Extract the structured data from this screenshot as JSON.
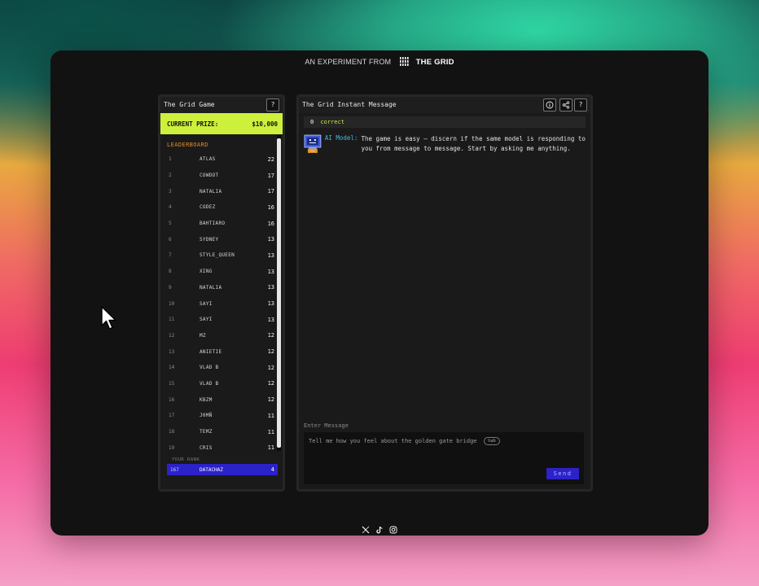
{
  "header": {
    "experiment_text": "AN EXPERIMENT FROM",
    "brand": "THE GRID"
  },
  "leaderboard_panel": {
    "title": "The Grid Game",
    "help_label": "?",
    "prize_label": "CURRENT PRIZE:",
    "prize_value": "$10,000",
    "leaderboard_title": "LEADERBOARD",
    "rows": [
      {
        "rank": "1",
        "name": "ATLAS",
        "score": "22"
      },
      {
        "rank": "2",
        "name": "COWDOT",
        "score": "17"
      },
      {
        "rank": "3",
        "name": "NATALIA",
        "score": "17"
      },
      {
        "rank": "4",
        "name": "CODEZ",
        "score": "16"
      },
      {
        "rank": "5",
        "name": "BAHTIARO",
        "score": "16"
      },
      {
        "rank": "6",
        "name": "SYDNEY",
        "score": "13"
      },
      {
        "rank": "7",
        "name": "STYLE_QUEEN",
        "score": "13"
      },
      {
        "rank": "8",
        "name": "XING",
        "score": "13"
      },
      {
        "rank": "9",
        "name": "NATALIA",
        "score": "13"
      },
      {
        "rank": "10",
        "name": "SAYI",
        "score": "13"
      },
      {
        "rank": "11",
        "name": "SAYI",
        "score": "13"
      },
      {
        "rank": "12",
        "name": "MZ",
        "score": "12"
      },
      {
        "rank": "13",
        "name": "ANIETIE",
        "score": "12"
      },
      {
        "rank": "14",
        "name": "VLAD B",
        "score": "12"
      },
      {
        "rank": "15",
        "name": "VLAD B",
        "score": "12"
      },
      {
        "rank": "16",
        "name": "KBZM",
        "score": "12"
      },
      {
        "rank": "17",
        "name": "J0MÑ",
        "score": "11"
      },
      {
        "rank": "18",
        "name": "TEMZ",
        "score": "11"
      },
      {
        "rank": "19",
        "name": "CRIS",
        "score": "11"
      }
    ],
    "your_rank_label": "YOUR RANK",
    "your_rank": {
      "rank": "167",
      "name": "DATACHAZ",
      "score": "4"
    }
  },
  "chat_panel": {
    "title": "The Grid Instant Message",
    "info_label": "i",
    "help_label": "?",
    "correct_count": "0",
    "correct_label": "correct",
    "message_sender": "AI Model:",
    "message_text": "The game is easy – discern if the same model is responding to you from message to message. Start by asking me anything.",
    "enter_label": "Enter Message",
    "input_placeholder": "Tell me how you feel about the golden gate bridge",
    "tab_hint": "tab",
    "send_label": "Send"
  },
  "footer": {
    "icons": [
      "x-icon",
      "tiktok-icon",
      "instagram-icon"
    ]
  },
  "colors": {
    "prize_bg": "#cdf03c",
    "leaderboard_title": "#e58a2a",
    "accent_blue": "#2b22c9",
    "sender_color": "#45b8e6",
    "correct_color": "#cde83f"
  }
}
